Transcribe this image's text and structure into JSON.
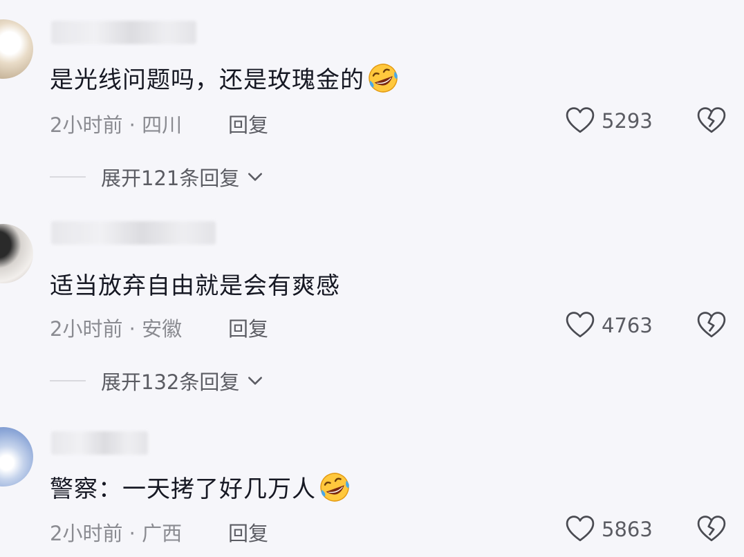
{
  "comments": [
    {
      "text": "是光线问题吗，还是玫瑰金的",
      "emoji": "rolling-on-floor-laughing-icon",
      "meta": "2小时前 · 四川",
      "reply_label": "回复",
      "likes": "5293",
      "expand_label": "展开121条回复"
    },
    {
      "text": "适当放弃自由就是会有爽感",
      "emoji": "",
      "meta": "2小时前 · 安徽",
      "reply_label": "回复",
      "likes": "4763",
      "expand_label": "展开132条回复"
    },
    {
      "text": "警察：一天拷了好几万人",
      "emoji": "rolling-on-floor-laughing-icon",
      "meta": "2小时前 · 广西",
      "reply_label": "回复",
      "likes": "5863"
    }
  ],
  "colors": {
    "background": "#f6f6fa",
    "text": "#161823",
    "secondary": "#8a8b91"
  }
}
